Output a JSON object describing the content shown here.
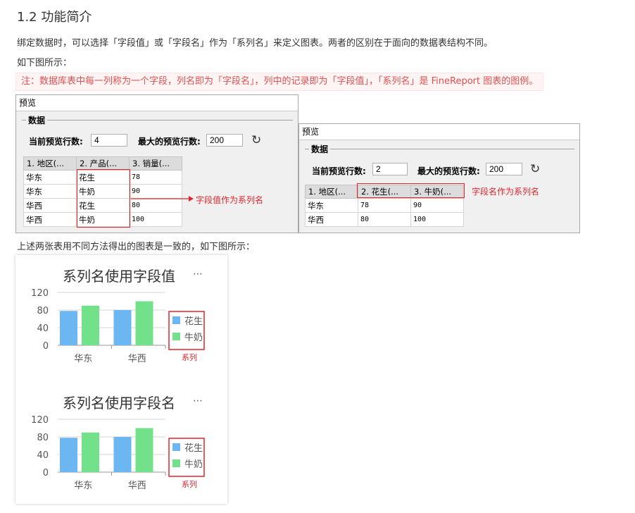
{
  "heading": "1.2 功能简介",
  "intro": "绑定数据时，可以选择「字段值」或「字段名」作为「系列名」来定义图表。两者的区别在于面向的数据表结构不同。",
  "see_below": "如下图所示：",
  "note": "注：数据库表中每一列称为一个字段，列名即为「字段名」，列中的记录即为「字段值」，「系列名」是 FineReport 图表的图例。",
  "left_window": {
    "title": "预览",
    "group": "数据",
    "current_rows_label": "当前预览行数:",
    "current_rows_value": "4",
    "max_rows_label": "最大的预览行数:",
    "max_rows_value": "200",
    "columns": [
      "1. 地区(...",
      "2. 产品(...",
      "3. 销量(..."
    ],
    "rows": [
      [
        "华东",
        "花生",
        "78"
      ],
      [
        "华东",
        "牛奶",
        "90"
      ],
      [
        "华西",
        "花生",
        "80"
      ],
      [
        "华西",
        "牛奶",
        "100"
      ]
    ],
    "annotation": "字段值作为系列名"
  },
  "right_window": {
    "title": "预览",
    "group": "数据",
    "current_rows_label": "当前预览行数:",
    "current_rows_value": "2",
    "max_rows_label": "最大的预览行数:",
    "max_rows_value": "200",
    "columns": [
      "1. 地区(...",
      "2. 花生(...",
      "3. 牛奶(..."
    ],
    "rows": [
      [
        "华东",
        "78",
        "90"
      ],
      [
        "华西",
        "80",
        "100"
      ]
    ],
    "annotation": "字段名作为系列名"
  },
  "consistent_note": "上述两张表用不同方法得出的图表是一致的，如下图所示：",
  "legend_annotation": "系列",
  "more_icon": "⋯",
  "colors": {
    "series1": "#6cb6f2",
    "series2": "#73e08a",
    "red": "#e3242b"
  },
  "chart_data": [
    {
      "type": "bar",
      "title": "系列名使用字段值",
      "categories": [
        "华东",
        "华西"
      ],
      "series": [
        {
          "name": "花生",
          "values": [
            78,
            80
          ]
        },
        {
          "name": "牛奶",
          "values": [
            90,
            100
          ]
        }
      ],
      "ylim": [
        0,
        120
      ],
      "yticks": [
        "0",
        "40",
        "80",
        "120"
      ],
      "grid": true,
      "legend": "right"
    },
    {
      "type": "bar",
      "title": "系列名使用字段名",
      "categories": [
        "华东",
        "华西"
      ],
      "series": [
        {
          "name": "花生",
          "values": [
            78,
            80
          ]
        },
        {
          "name": "牛奶",
          "values": [
            90,
            100
          ]
        }
      ],
      "ylim": [
        0,
        120
      ],
      "yticks": [
        "0",
        "40",
        "80",
        "120"
      ],
      "grid": true,
      "legend": "right"
    }
  ]
}
